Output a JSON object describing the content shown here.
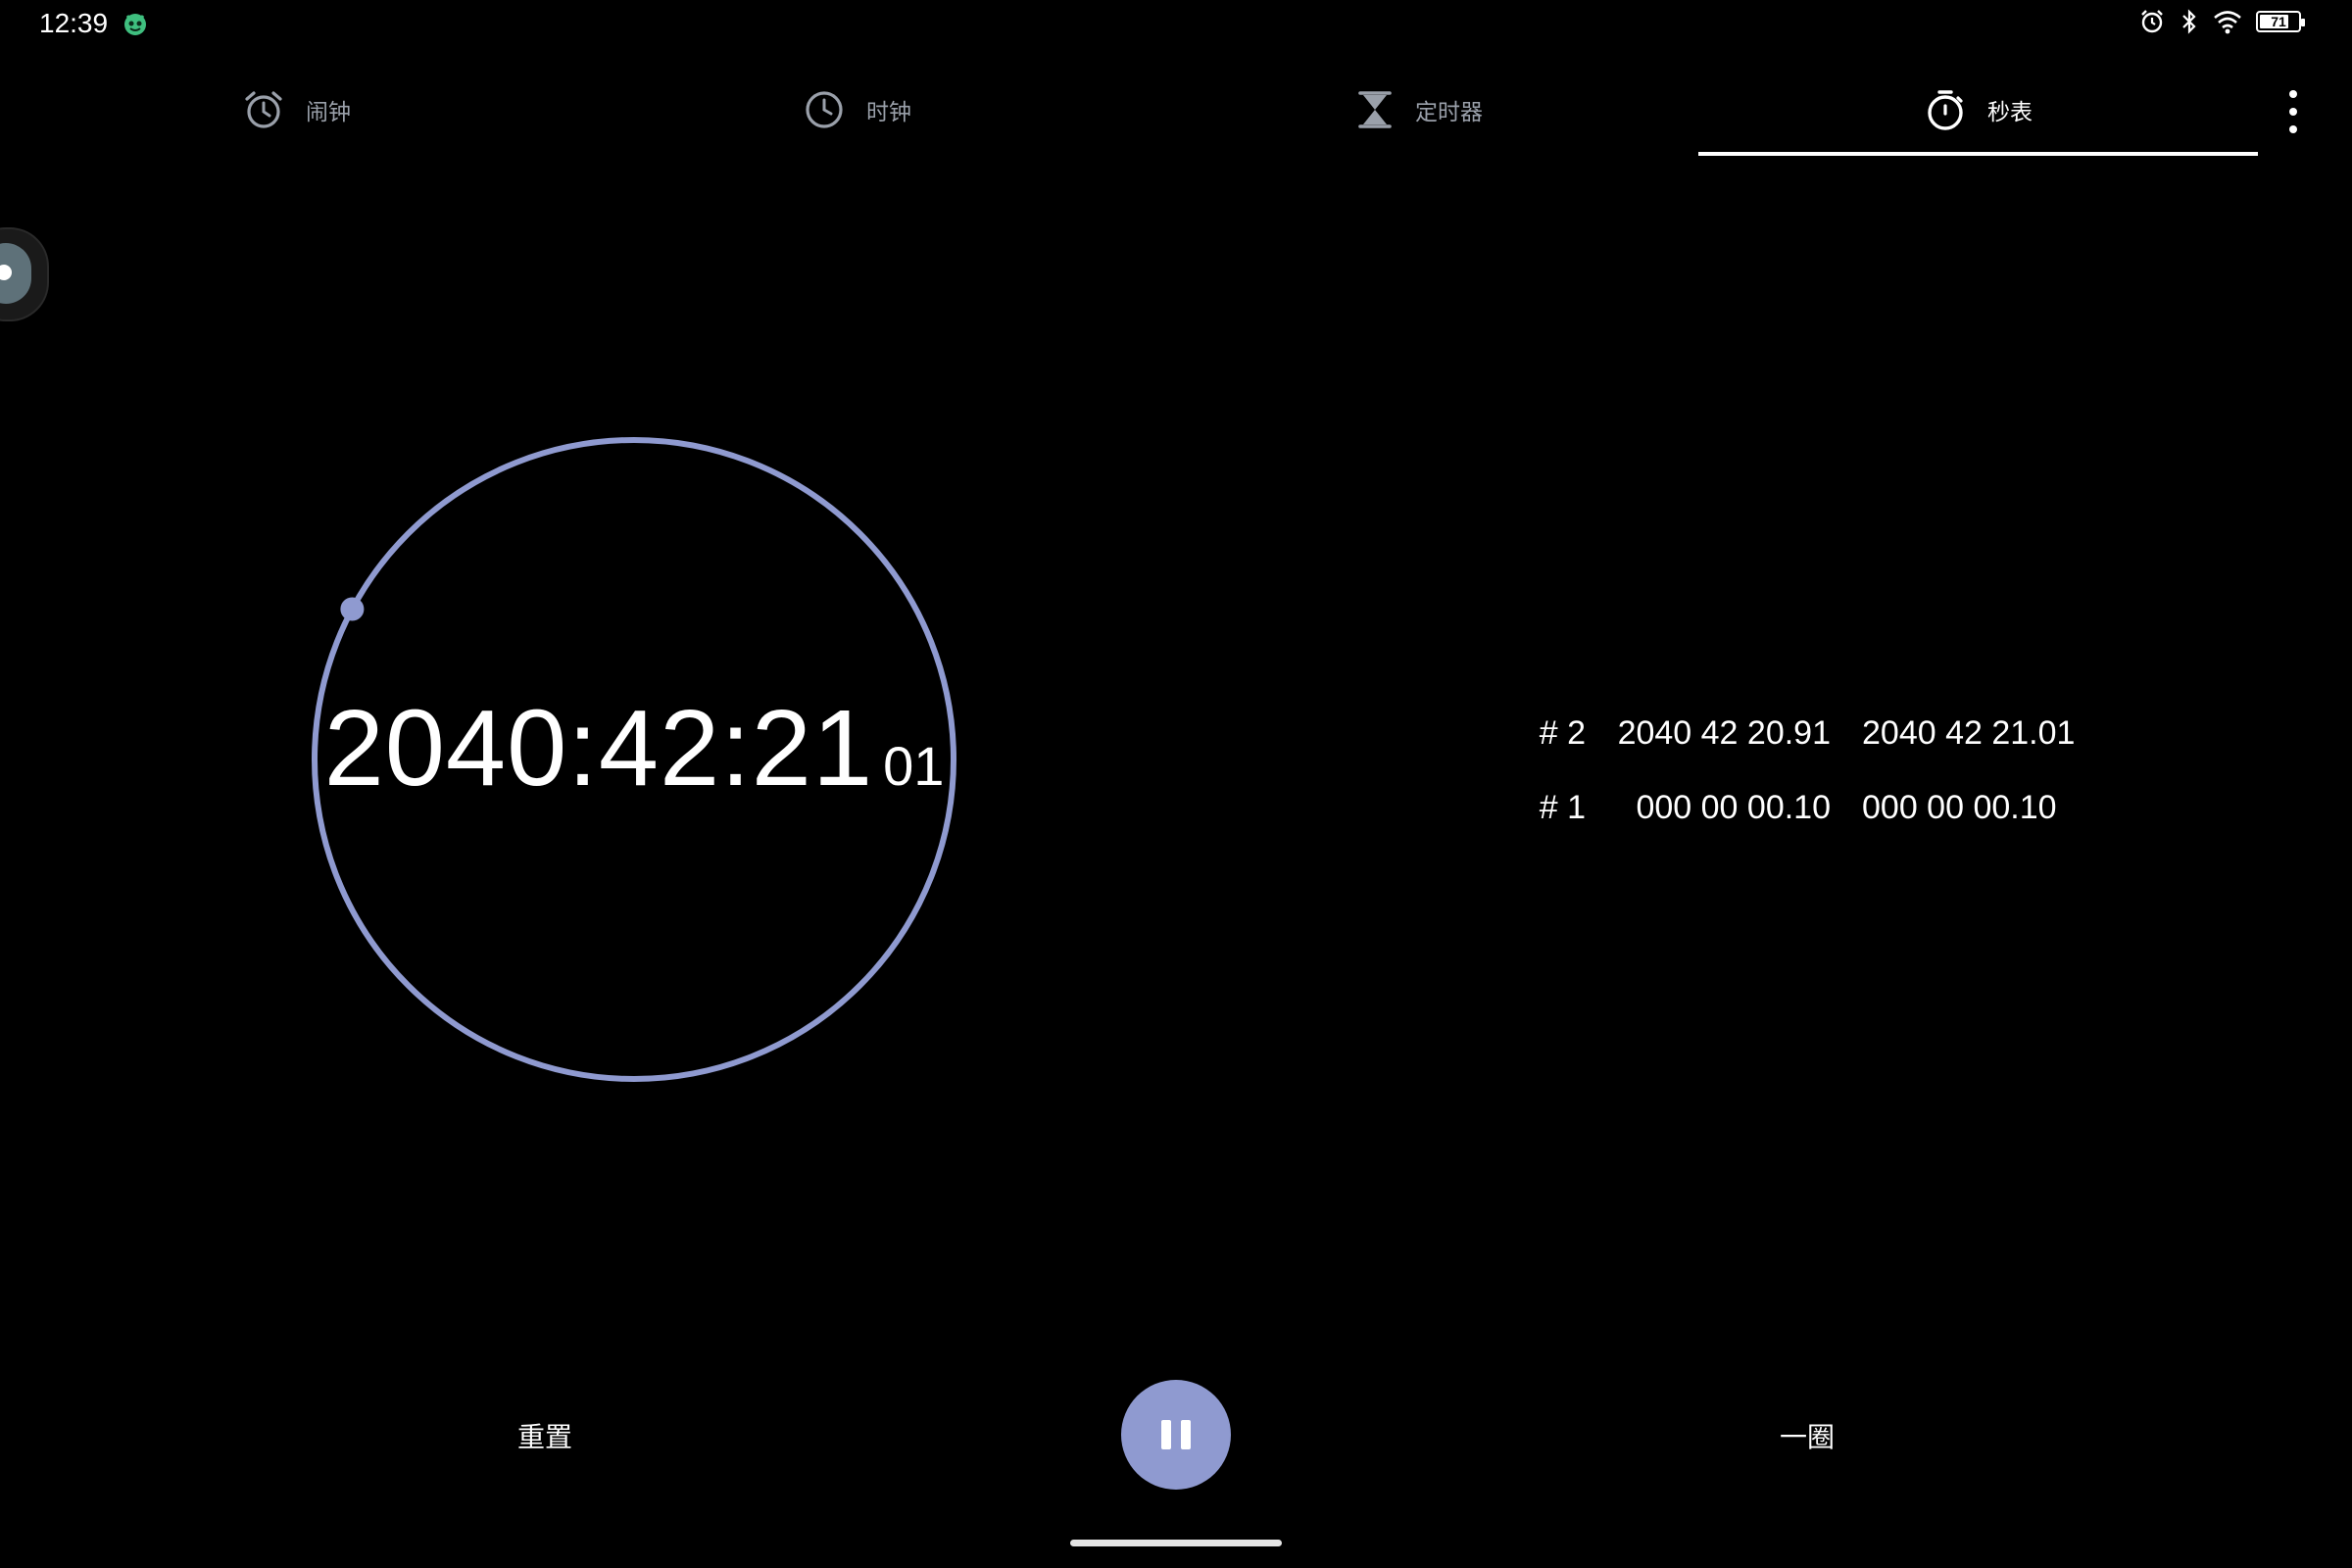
{
  "status_bar": {
    "time": "12:39",
    "battery": "71"
  },
  "tabs": [
    {
      "label": "闹钟",
      "icon": "alarm-icon",
      "active": false
    },
    {
      "label": "时钟",
      "icon": "clock-icon",
      "active": false
    },
    {
      "label": "定时器",
      "icon": "hourglass-icon",
      "active": false
    },
    {
      "label": "秒表",
      "icon": "stopwatch-icon",
      "active": true
    }
  ],
  "stopwatch": {
    "main": "2040:42:21",
    "hundredths": "01"
  },
  "laps": [
    {
      "num": "# 2",
      "lap": "2040 42 20.91",
      "total": "2040 42 21.01"
    },
    {
      "num": "# 1",
      "lap": "000 00 00.10",
      "total": "000 00 00.10"
    }
  ],
  "controls": {
    "reset_label": "重置",
    "lap_label": "一圈"
  },
  "colors": {
    "accent": "#8f9ad0",
    "background": "#000000",
    "tab_inactive": "#9aa0aa"
  }
}
